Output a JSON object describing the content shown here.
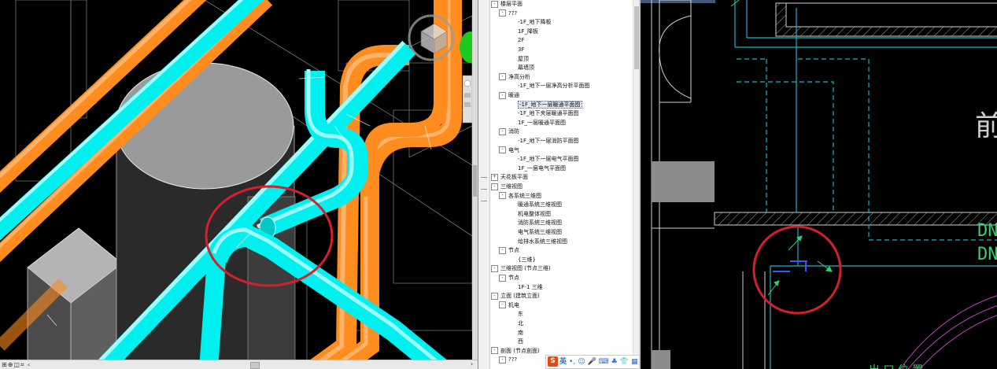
{
  "colors": {
    "duct_cyan": "#00f0f0",
    "pipe_orange": "#ff8c1e",
    "highlight_red": "#d4202a",
    "cad_cyan": "#19b5c6",
    "cad_green": "#32d070",
    "cad_magenta": "#c040c0"
  },
  "viewport3d": {
    "statusbar_icons": "⊞⊕◫⌗ ‹",
    "scroll_right": "›"
  },
  "project_browser": {
    "tree": [
      {
        "label": "楼层平面",
        "level": 1,
        "toggle": "-"
      },
      {
        "label": "???",
        "level": 2,
        "toggle": "-"
      },
      {
        "label": "-1F_地下降板",
        "level": 3
      },
      {
        "label": "1F_降板",
        "level": 3
      },
      {
        "label": "2F",
        "level": 3
      },
      {
        "label": "3F",
        "level": 3
      },
      {
        "label": "屋顶",
        "level": 3
      },
      {
        "label": "幕墙顶",
        "level": 3
      },
      {
        "label": "净高分析",
        "level": 2,
        "toggle": "-"
      },
      {
        "label": "-1F_地下一层净高分析平面图",
        "level": 3
      },
      {
        "label": "暖通",
        "level": 2,
        "toggle": "-"
      },
      {
        "label": "-1F_地下一层暖通平面图",
        "level": 3,
        "selected": true
      },
      {
        "label": "-1F_地下夹层暖通平面图",
        "level": 3
      },
      {
        "label": "1F_一层暖通平面图",
        "level": 3
      },
      {
        "label": "消防",
        "level": 2,
        "toggle": "-"
      },
      {
        "label": "-1F_地下一层消防平面图",
        "level": 3
      },
      {
        "label": "电气",
        "level": 2,
        "toggle": "-"
      },
      {
        "label": "-1F_地下一层电气平面图",
        "level": 3
      },
      {
        "label": "1F_一层电气平面图",
        "level": 3
      },
      {
        "label": "天花板平面",
        "level": 1,
        "toggle": "+"
      },
      {
        "label": "三维视图",
        "level": 1,
        "toggle": "-"
      },
      {
        "label": "各系统三维图",
        "level": 2,
        "toggle": "-"
      },
      {
        "label": "暖通系统三维视图",
        "level": 3
      },
      {
        "label": "机电整体视图",
        "level": 3
      },
      {
        "label": "消防系统三维视图",
        "level": 3
      },
      {
        "label": "电气系统三维视图",
        "level": 3
      },
      {
        "label": "给排水系统三维视图",
        "level": 3
      },
      {
        "label": "节点",
        "level": 2,
        "toggle": "-"
      },
      {
        "label": "{三维}",
        "level": 3
      },
      {
        "label": "三维视图 (节点三维)",
        "level": 1,
        "toggle": "-"
      },
      {
        "label": "节点",
        "level": 2,
        "toggle": "-"
      },
      {
        "label": "1F-1 三维",
        "level": 3
      },
      {
        "label": "立面 (建筑立面)",
        "level": 1,
        "toggle": "-"
      },
      {
        "label": "机电",
        "level": 2,
        "toggle": "-"
      },
      {
        "label": "东",
        "level": 3
      },
      {
        "label": "北",
        "level": 3
      },
      {
        "label": "南",
        "level": 3
      },
      {
        "label": "西",
        "level": 3
      },
      {
        "label": "剖面 (节点剖面)",
        "level": 1,
        "toggle": "-"
      },
      {
        "label": "???",
        "level": 2,
        "toggle": "-"
      }
    ]
  },
  "ime_toolbar": {
    "logo": "S",
    "lang": "英",
    "icons": [
      "•,",
      "☺",
      "🎤",
      "⌨",
      "♣",
      "👕",
      "▦"
    ]
  },
  "cad": {
    "labels": [
      "DN",
      "DN"
    ],
    "partial_glyph": "前"
  }
}
